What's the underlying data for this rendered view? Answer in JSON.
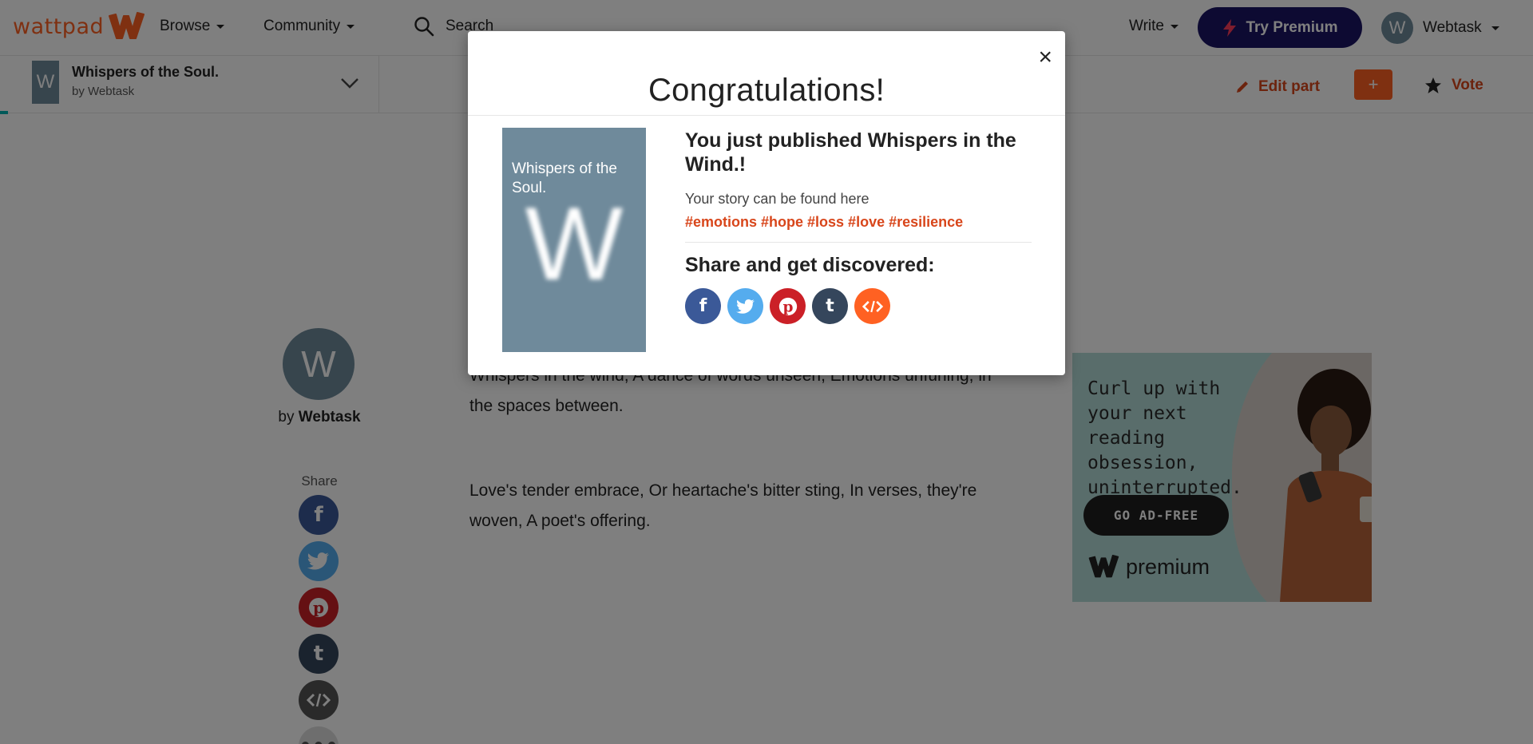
{
  "nav": {
    "logo": "wattpad",
    "browse": "Browse",
    "community": "Community",
    "search_placeholder": "Search",
    "write": "Write",
    "premium": "Try Premium",
    "user_initial": "W",
    "username": "Webtask"
  },
  "storybar": {
    "cover_letter": "W",
    "title": "Whispers of the Soul.",
    "byline": "by Webtask",
    "edit_part": "Edit part",
    "add": "+",
    "vote": "Vote"
  },
  "author": {
    "initial": "W",
    "by": "by",
    "name": "Webtask",
    "share_label": "Share"
  },
  "story": {
    "paragraphs": [
      "Whispers in the wind, A dance of words unseen, Emotions unfurling, in the spaces between.",
      "Love's tender embrace, Or heartache's bitter sting, In verses, they're woven, A poet's offering."
    ]
  },
  "ad": {
    "headline": "Curl up with your next reading obsession, uninterrupted.",
    "cta": "GO AD-FREE",
    "brand": "premium"
  },
  "modal": {
    "title": "Congratulations!",
    "close": "×",
    "cover_title": "Whispers of the Soul.",
    "cover_letter": "W",
    "published": "You just published Whispers in the Wind.!",
    "found": "Your story can be found here",
    "tags": "#emotions #hope #loss #love #resilience",
    "discover": "Share and get discovered:"
  },
  "share_icons": [
    "facebook-icon",
    "twitter-icon",
    "pinterest-icon",
    "tumblr-icon",
    "embed-icon"
  ],
  "colors": {
    "brand": "#ff6122",
    "premium": "#1b1464",
    "facebook": "#3b5998",
    "twitter": "#55acee",
    "pinterest": "#cb2027",
    "tumblr": "#35465c",
    "embed": "#ff6122",
    "cover": "#6f8a9b"
  }
}
